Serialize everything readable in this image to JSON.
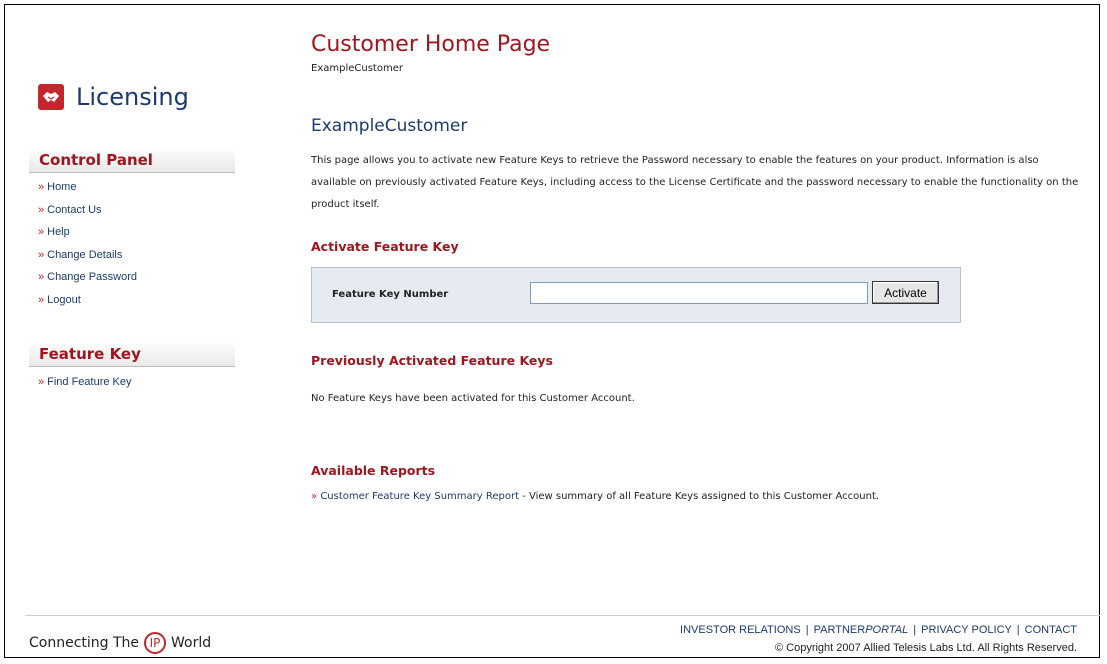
{
  "brand": {
    "name": "Licensing",
    "tagline_before": "Connecting The",
    "tagline_ip": "IP",
    "tagline_after": "World"
  },
  "colors": {
    "brand_red": "#c2272d",
    "title_red": "#a0161e",
    "navy": "#1b3b6f",
    "panel_bg": "#e6ebf2"
  },
  "sidebar": {
    "control_panel": {
      "heading": "Control Panel",
      "items": [
        {
          "label": "Home"
        },
        {
          "label": "Contact Us"
        },
        {
          "label": "Help"
        },
        {
          "label": "Change Details"
        },
        {
          "label": "Change Password"
        },
        {
          "label": "Logout"
        }
      ]
    },
    "feature_key": {
      "heading": "Feature Key",
      "items": [
        {
          "label": "Find Feature Key"
        }
      ]
    },
    "bullet": "»"
  },
  "main": {
    "title": "Customer Home Page",
    "subtitle": "ExampleCustomer",
    "customer_heading": "ExampleCustomer",
    "intro": "This page allows you to activate new Feature Keys to retrieve the Password necessary to enable the features on your product. Information is also available on previously activated Feature Keys, including access to the License Certificate and the password necessary to enable the functionality on the product itself.",
    "activate": {
      "heading": "Activate Feature Key",
      "field_label": "Feature Key Number",
      "input_value": "",
      "button_label": "Activate"
    },
    "previous": {
      "heading": "Previously Activated Feature Keys",
      "message": "No Feature Keys have been activated for this Customer Account."
    },
    "reports": {
      "heading": "Available Reports",
      "link_label": "Customer Feature Key Summary Report",
      "description": " - View summary of all Feature Keys assigned to this Customer Account."
    }
  },
  "footer": {
    "links": {
      "investor": "INVESTOR RELATIONS",
      "partner_a": "PARTNER",
      "partner_b": "PORTAL",
      "privacy": "PRIVACY POLICY",
      "contact": "CONTACT"
    },
    "separator": "|",
    "copyright": "© Copyright 2007   Allied Telesis Labs Ltd.   All Rights Reserved."
  }
}
